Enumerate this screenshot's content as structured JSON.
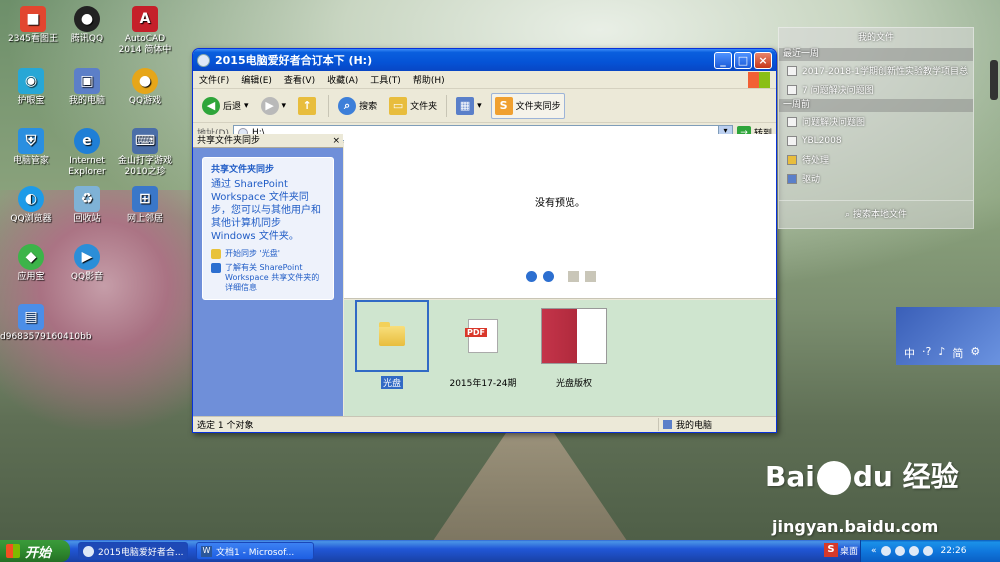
{
  "desktop": {
    "icons": [
      {
        "label": "2345看图王"
      },
      {
        "label": "腾讯QQ"
      },
      {
        "label": "AutoCAD 2014 简体中"
      },
      {
        "label": "护眼宝"
      },
      {
        "label": "我的电脑"
      },
      {
        "label": "QQ游戏"
      },
      {
        "label": "电脑管家"
      },
      {
        "label": "Internet Explorer"
      },
      {
        "label": "金山打字游戏2010之珍"
      },
      {
        "label": "QQ浏览器"
      },
      {
        "label": "回收站"
      },
      {
        "label": "网上邻居"
      },
      {
        "label": "应用宝"
      },
      {
        "label": "QQ影音"
      },
      {
        "label": "d9683579160410bb"
      }
    ]
  },
  "window": {
    "title": "2015电脑爱好者合订本下 (H:)",
    "menu": [
      "文件(F)",
      "编辑(E)",
      "查看(V)",
      "收藏(A)",
      "工具(T)",
      "帮助(H)"
    ],
    "toolbar": {
      "back": "后退",
      "search": "搜索",
      "folders": "文件夹",
      "sync": "文件夹同步"
    },
    "address": {
      "label": "地址(D)",
      "value": "H:\\",
      "go": "转到"
    },
    "left_pane": {
      "header": "共享文件夹同步",
      "close": "×",
      "box_title": "共享文件夹同步",
      "description": "通过 SharePoint Workspace 文件夹同步，您可以与其他用户和其他计算机同步 Windows 文件夹。",
      "task1": "开始同步 '光盘'",
      "task2": "了解有关 SharePoint Workspace 共享文件夹的详细信息"
    },
    "preview": {
      "text": "没有预览。"
    },
    "files": [
      {
        "name": "光盘",
        "type": "folder",
        "selected": true
      },
      {
        "name": "2015年17-24期",
        "type": "pdf",
        "selected": false
      },
      {
        "name": "光盘版权",
        "type": "image",
        "selected": false
      }
    ],
    "status": {
      "left": "选定 1 个对象",
      "right": "我的电脑"
    }
  },
  "gadget": {
    "title": "我的文件",
    "section1": "最近一周",
    "items1": [
      "2017-2018-1学期创新性实验教学项目总",
      "7 问题解决问题图"
    ],
    "section2": "一周前",
    "items2": [
      "问题解决问题图",
      "YBL2008",
      "待处理",
      "驱动"
    ],
    "search": "搜索本地文件"
  },
  "ime": {
    "items": [
      "中",
      "·?",
      "♪",
      "简",
      "⚙"
    ]
  },
  "taskbar": {
    "start": "开始",
    "tasks": [
      "2015电脑爱好者合...",
      "文档1 - Microsof..."
    ],
    "desktop_label": "桌面",
    "time": "22:26"
  },
  "watermark": {
    "brand": "Bai du 经验",
    "url": "jingyan.baidu.com"
  },
  "colors": {
    "xp_blue": "#0553d6",
    "start_green": "#2f8a2f",
    "task_pane_blue": "#6f8fd9",
    "selection": "#316ac5"
  }
}
